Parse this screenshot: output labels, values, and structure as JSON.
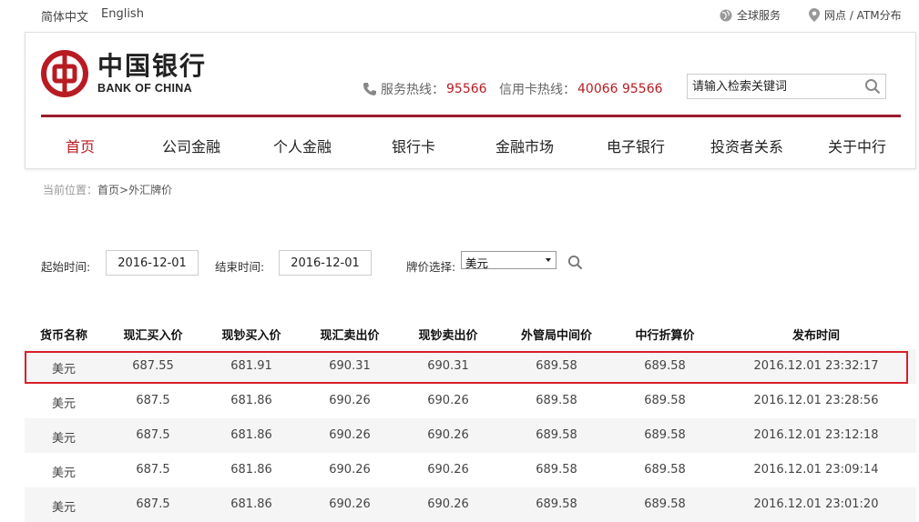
{
  "topbar": {
    "lang_zh": "简体中文",
    "lang_en": "English",
    "global_service": "全球服务",
    "branch_atm": "网点 / ATM分布"
  },
  "header": {
    "logo_cn": "中国银行",
    "logo_en": "BANK OF CHINA",
    "service_hotline_label": "服务热线：",
    "service_hotline_number": "95566",
    "card_hotline_label": "信用卡热线：",
    "card_hotline_number": "40066 95566",
    "search_placeholder": "请输入检索关键词"
  },
  "nav": {
    "items": [
      {
        "label": "首页"
      },
      {
        "label": "公司金融"
      },
      {
        "label": "个人金融"
      },
      {
        "label": "银行卡"
      },
      {
        "label": "金融市场"
      },
      {
        "label": "电子银行"
      },
      {
        "label": "投资者关系"
      },
      {
        "label": "关于中行"
      }
    ]
  },
  "breadcrumb": {
    "prefix": "当前位置：",
    "path": "首页>外汇牌价"
  },
  "filter": {
    "start_label": "起始时间:",
    "start_value": "2016-12-01",
    "end_label": "结束时间:",
    "end_value": "2016-12-01",
    "currency_label": "牌价选择:",
    "currency_value": "美元"
  },
  "table": {
    "headers": [
      "货币名称",
      "现汇买入价",
      "现钞买入价",
      "现汇卖出价",
      "现钞卖出价",
      "外管局中间价",
      "中行折算价",
      "发布时间"
    ],
    "rows": [
      [
        "美元",
        "687.55",
        "681.91",
        "690.31",
        "690.31",
        "689.58",
        "689.58",
        "2016.12.01 23:32:17"
      ],
      [
        "美元",
        "687.5",
        "681.86",
        "690.26",
        "690.26",
        "689.58",
        "689.58",
        "2016.12.01 23:28:56"
      ],
      [
        "美元",
        "687.5",
        "681.86",
        "690.26",
        "690.26",
        "689.58",
        "689.58",
        "2016.12.01 23:12:18"
      ],
      [
        "美元",
        "687.5",
        "681.86",
        "690.26",
        "690.26",
        "689.58",
        "689.58",
        "2016.12.01 23:09:14"
      ],
      [
        "美元",
        "687.5",
        "681.86",
        "690.26",
        "690.26",
        "689.58",
        "689.58",
        "2016.12.01 23:01:20"
      ]
    ]
  },
  "colors": {
    "brand_red": "#b81c22",
    "rule_red": "#9b1c2c",
    "highlight_red": "#d9202a"
  }
}
